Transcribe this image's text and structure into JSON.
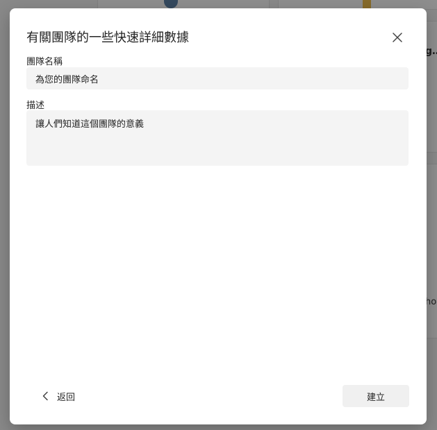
{
  "background": {
    "partial_text_1": "g…",
    "partial_text_2": "ho"
  },
  "dialog": {
    "title": "有關團隊的一些快速詳細數據",
    "close_icon": "close-icon",
    "name_field": {
      "label": "團隊名稱",
      "placeholder": "為您的團隊命名"
    },
    "description_field": {
      "label": "描述",
      "placeholder": "讓人們知道這個團隊的意義"
    },
    "back_button": {
      "icon": "chevron-left-icon",
      "label": "返回"
    },
    "create_button": {
      "label": "建立"
    }
  }
}
